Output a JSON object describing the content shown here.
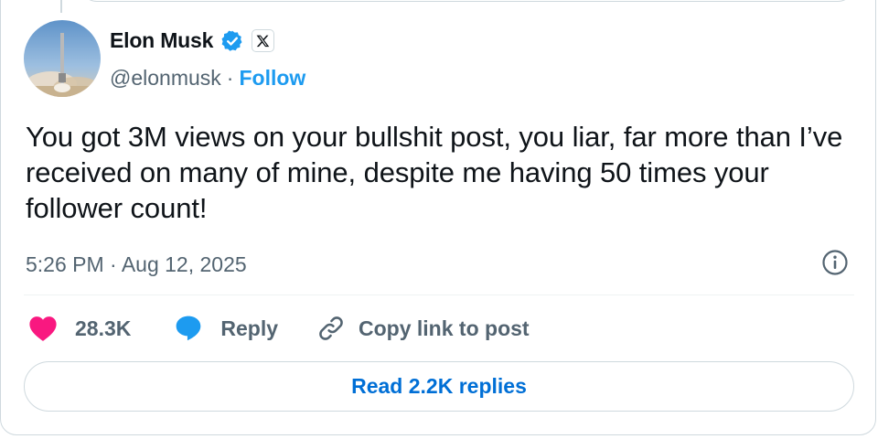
{
  "author": {
    "name": "Elon Musk",
    "handle": "@elonmusk",
    "separator": "·",
    "follow_label": "Follow",
    "verified": true,
    "affiliation_badge": "x-logo-icon"
  },
  "tweet": {
    "text": "You got 3M views on your bullshit post, you liar, far more than I’ve received on many of mine, despite me having 50 times your follower count!",
    "timestamp": "5:26 PM · Aug 12, 2025"
  },
  "actions": {
    "likes_count": "28.3K",
    "reply_label": "Reply",
    "copy_link_label": "Copy link to post"
  },
  "replies_button_label": "Read 2.2K replies",
  "colors": {
    "accent_blue": "#1d9bf0",
    "link_blue": "#006fd6",
    "like_pink": "#f91880",
    "text_primary": "#0f1419",
    "text_secondary": "#536471",
    "border": "#cfd9de"
  },
  "icons": {
    "info": "info-icon",
    "like": "heart-icon",
    "reply": "reply-bubble-icon",
    "copy_link": "link-icon",
    "verified": "verified-badge-icon"
  }
}
